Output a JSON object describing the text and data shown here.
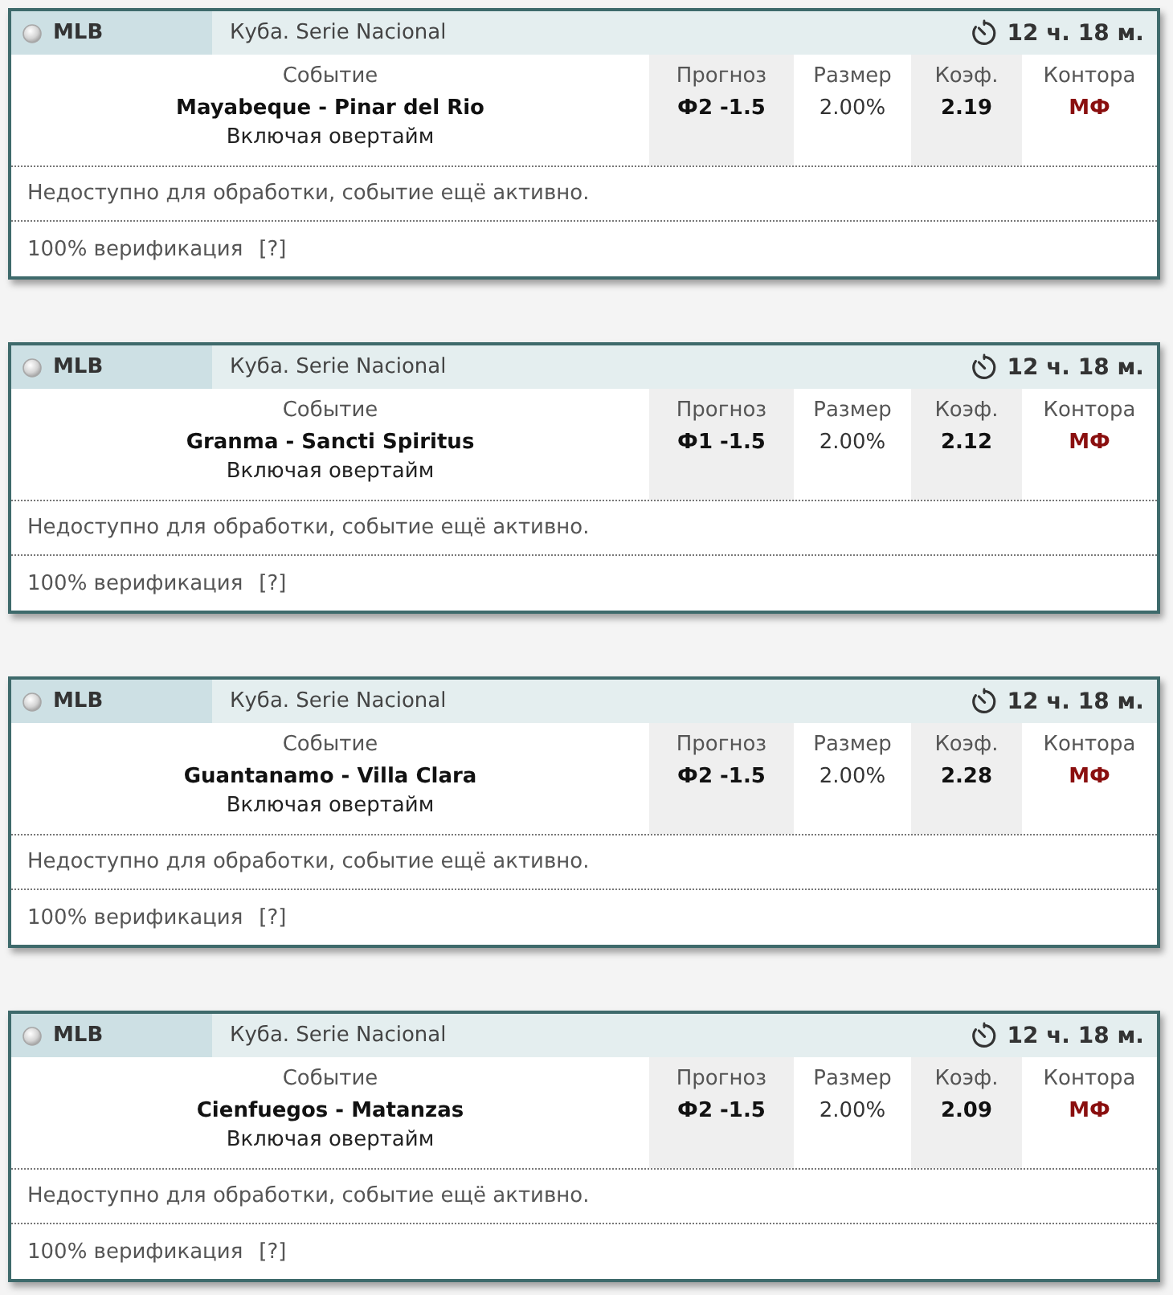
{
  "cards": [
    {
      "league": "MLB",
      "tournament": "Куба. Serie Nacional",
      "time_left": "12 ч. 18 м.",
      "event": {
        "heading": "Событие",
        "teams": "Mayabeque - Pinar del Rio",
        "note": "Включая овертайм"
      },
      "columns": [
        {
          "kind": "forecast",
          "heading": "Прогноз",
          "value": "Ф2 -1.5"
        },
        {
          "kind": "stake",
          "heading": "Размер",
          "value": "2.00%"
        },
        {
          "kind": "odds",
          "heading": "Коэф.",
          "value": "2.19"
        },
        {
          "kind": "bookmaker",
          "heading": "Контора",
          "value": "МФ"
        }
      ],
      "status": "Недоступно для обработки, событие ещё активно.",
      "verification": "100% верификация",
      "help": "[?]"
    },
    {
      "league": "MLB",
      "tournament": "Куба. Serie Nacional",
      "time_left": "12 ч. 18 м.",
      "event": {
        "heading": "Событие",
        "teams": "Granma - Sancti Spiritus",
        "note": "Включая овертайм"
      },
      "columns": [
        {
          "kind": "forecast",
          "heading": "Прогноз",
          "value": "Ф1 -1.5"
        },
        {
          "kind": "stake",
          "heading": "Размер",
          "value": "2.00%"
        },
        {
          "kind": "odds",
          "heading": "Коэф.",
          "value": "2.12"
        },
        {
          "kind": "bookmaker",
          "heading": "Контора",
          "value": "МФ"
        }
      ],
      "status": "Недоступно для обработки, событие ещё активно.",
      "verification": "100% верификация",
      "help": "[?]"
    },
    {
      "league": "MLB",
      "tournament": "Куба. Serie Nacional",
      "time_left": "12 ч. 18 м.",
      "event": {
        "heading": "Событие",
        "teams": "Guantanamo - Villa Clara",
        "note": "Включая овертайм"
      },
      "columns": [
        {
          "kind": "forecast",
          "heading": "Прогноз",
          "value": "Ф2 -1.5"
        },
        {
          "kind": "stake",
          "heading": "Размер",
          "value": "2.00%"
        },
        {
          "kind": "odds",
          "heading": "Коэф.",
          "value": "2.28"
        },
        {
          "kind": "bookmaker",
          "heading": "Контора",
          "value": "МФ"
        }
      ],
      "status": "Недоступно для обработки, событие ещё активно.",
      "verification": "100% верификация",
      "help": "[?]"
    },
    {
      "league": "MLB",
      "tournament": "Куба. Serie Nacional",
      "time_left": "12 ч. 18 м.",
      "event": {
        "heading": "Событие",
        "teams": "Cienfuegos - Matanzas",
        "note": "Включая овертайм"
      },
      "columns": [
        {
          "kind": "forecast",
          "heading": "Прогноз",
          "value": "Ф2 -1.5"
        },
        {
          "kind": "stake",
          "heading": "Размер",
          "value": "2.00%"
        },
        {
          "kind": "odds",
          "heading": "Коэф.",
          "value": "2.09"
        },
        {
          "kind": "bookmaker",
          "heading": "Контора",
          "value": "МФ"
        }
      ],
      "status": "Недоступно для обработки, событие ещё активно.",
      "verification": "100% верификация",
      "help": "[?]"
    }
  ]
}
